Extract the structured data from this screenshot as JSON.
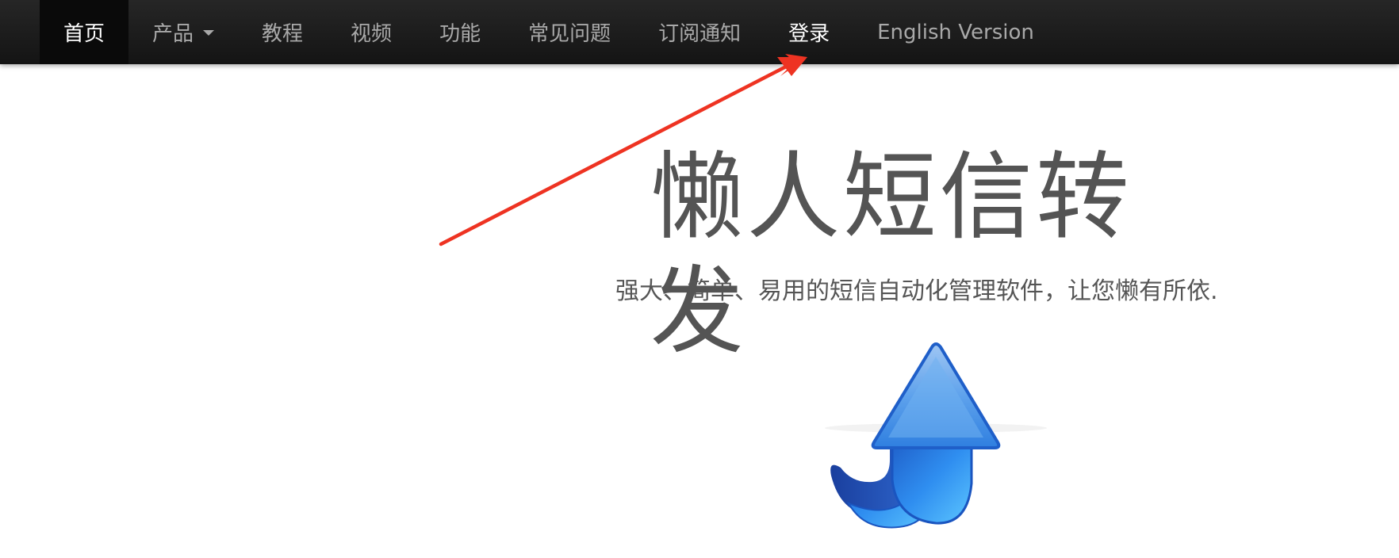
{
  "nav": {
    "items": [
      {
        "label": "首页",
        "active": true
      },
      {
        "label": "产品",
        "dropdown": true
      },
      {
        "label": "教程"
      },
      {
        "label": "视频"
      },
      {
        "label": "功能"
      },
      {
        "label": "常见问题"
      },
      {
        "label": "订阅通知"
      },
      {
        "label": "登录",
        "highlight": true
      },
      {
        "label": "English Version"
      }
    ]
  },
  "hero": {
    "title": "懒人短信转发",
    "subtitle": "强大、简单、易用的短信自动化管理软件，让您懒有所依."
  },
  "colors": {
    "nav_bg": "#1a1a1a",
    "nav_text": "#a9a9a9",
    "nav_active_text": "#ffffff",
    "annotation_arrow": "#ee3322",
    "hero_text": "#545454",
    "up_arrow_blue": "#2f8cf0"
  },
  "icons": {
    "annotation": "red-pointer-arrow-icon",
    "hero_graphic": "blue-up-arrow-icon"
  }
}
